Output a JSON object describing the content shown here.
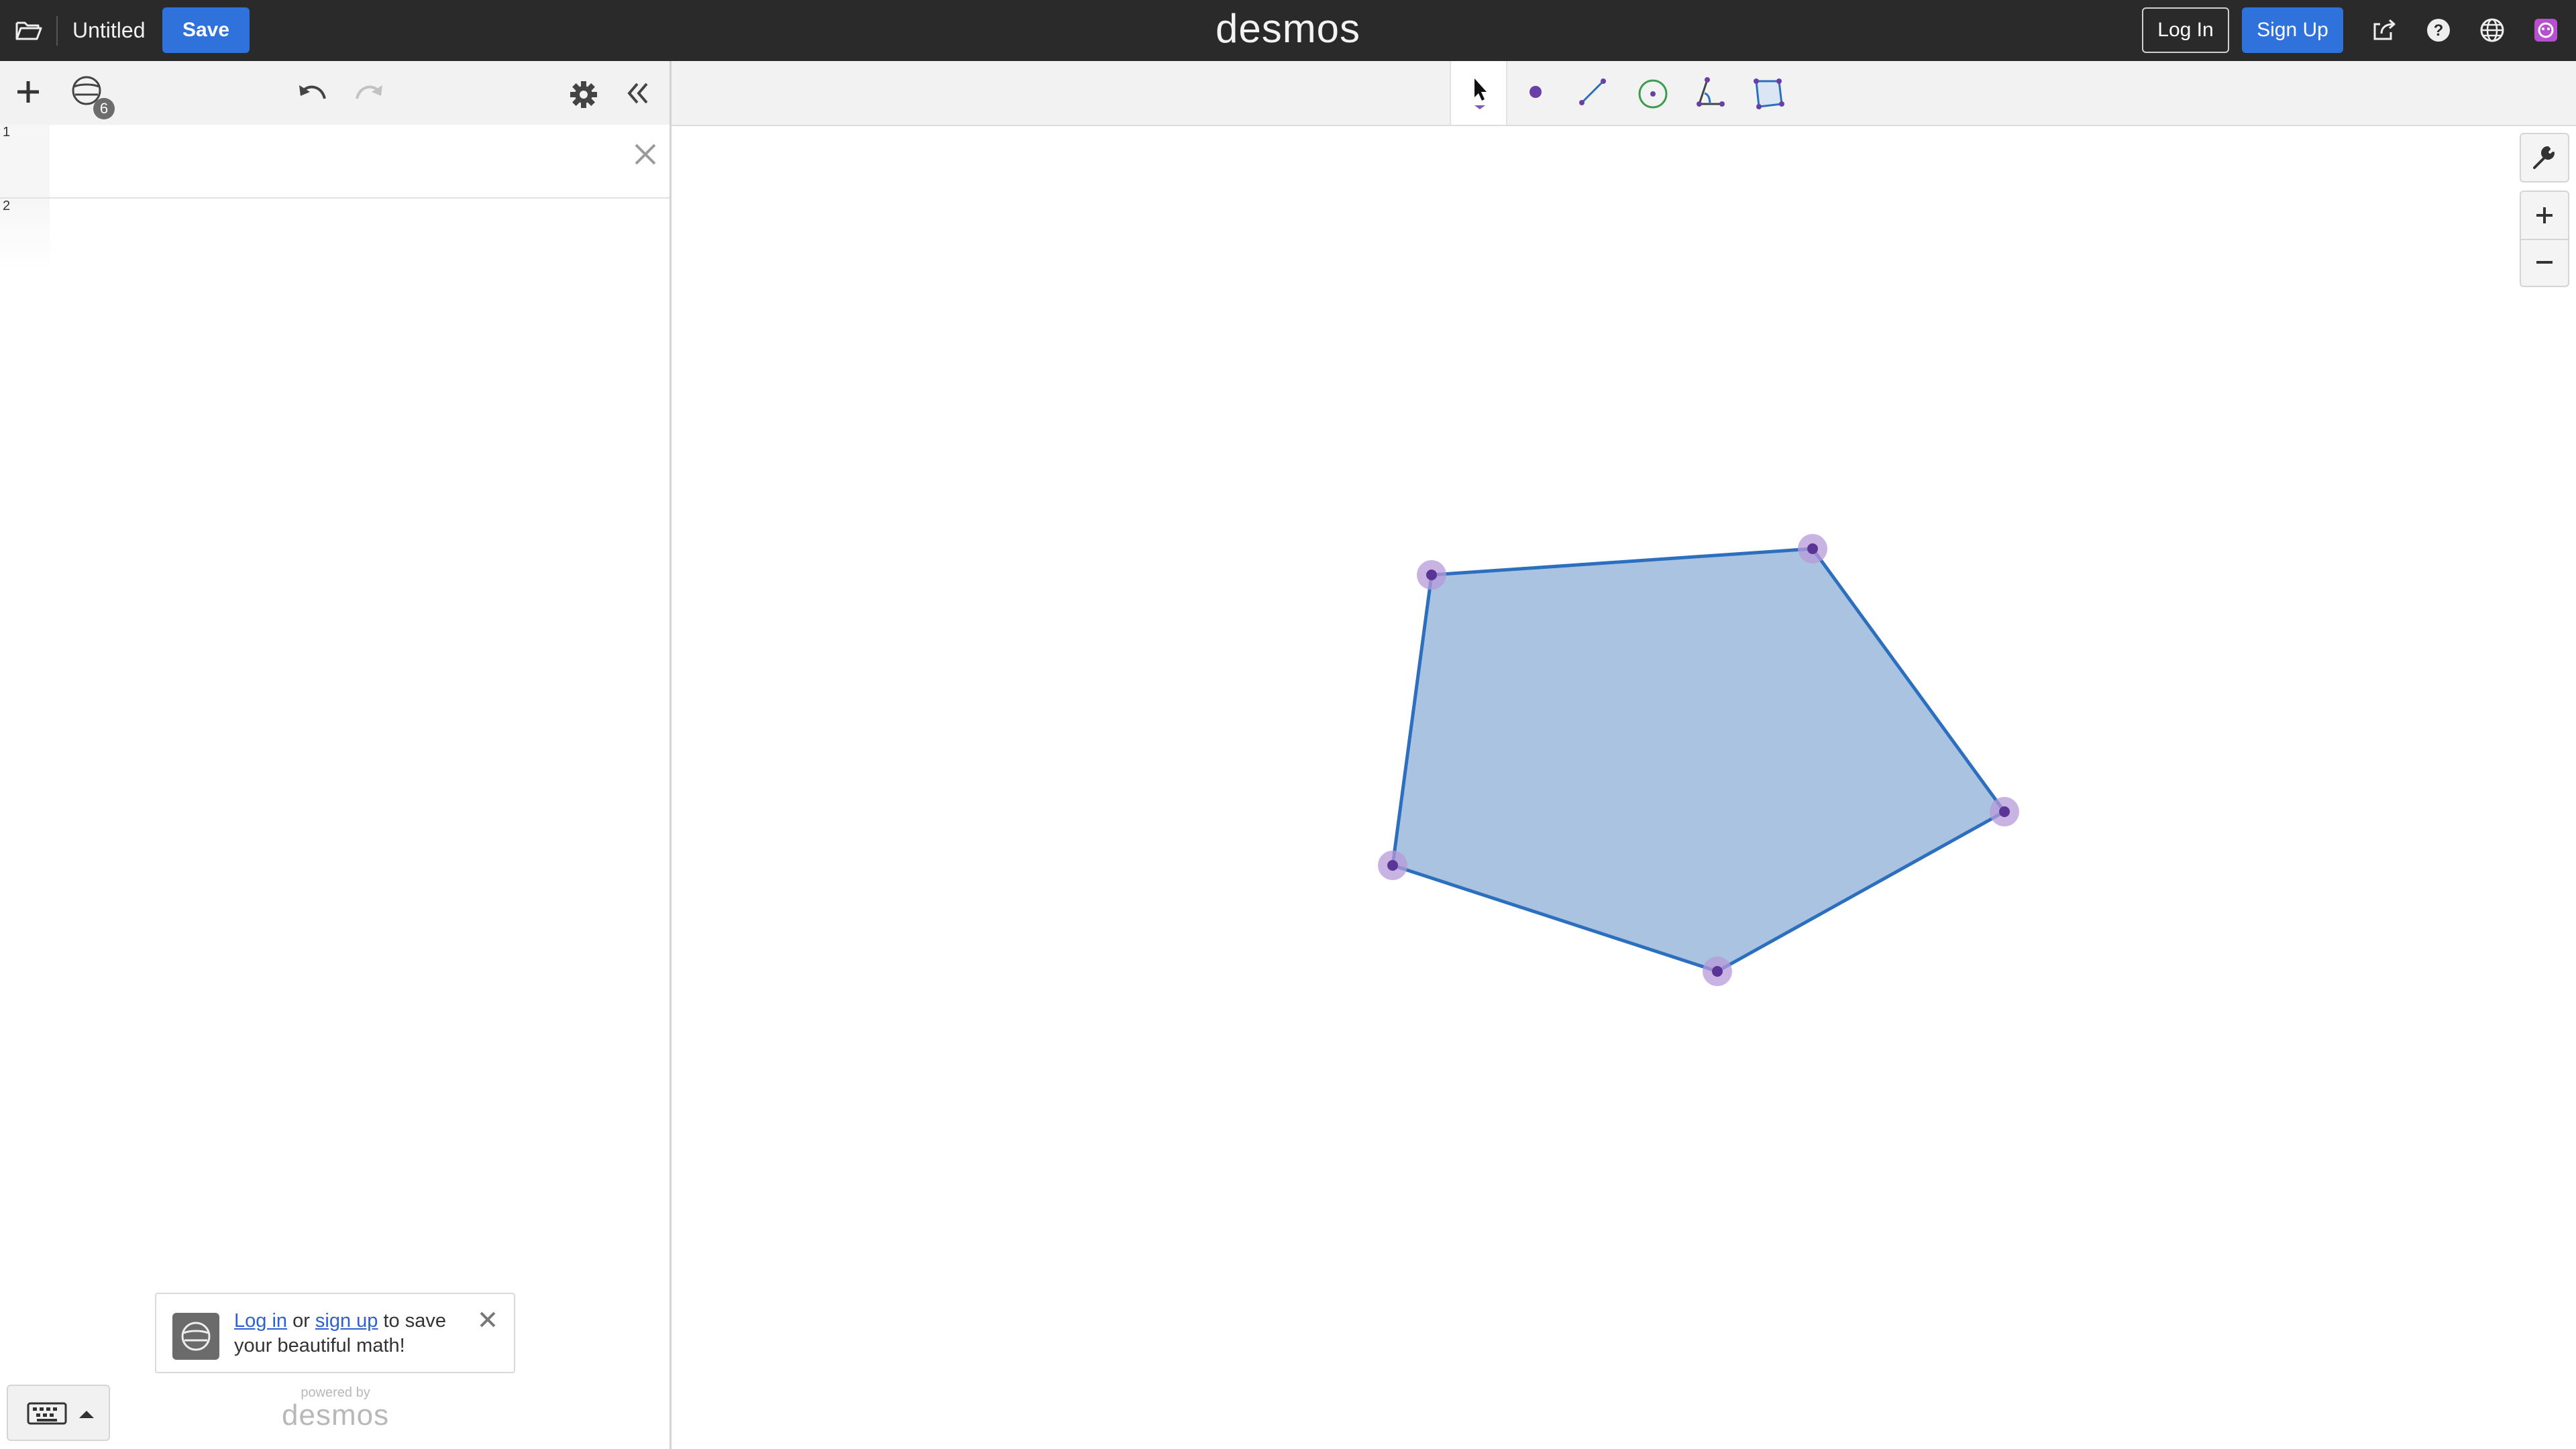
{
  "topbar": {
    "title": "Untitled",
    "save_label": "Save",
    "logo": "desmos",
    "login_label": "Log In",
    "signup_label": "Sign Up"
  },
  "expressions": {
    "graph_settings_badge": "6",
    "rows": [
      {
        "number": "1"
      },
      {
        "number": "2"
      }
    ]
  },
  "toast": {
    "login_link": "Log in",
    "or_text": " or ",
    "signup_link": "sign up",
    "message": " to save your beautiful math!"
  },
  "powered_by": {
    "small": "powered by",
    "big": "desmos"
  },
  "geometry_tools": [
    "select",
    "point",
    "segment",
    "circle",
    "angle",
    "polygon"
  ],
  "polygon": {
    "fill_color": "#a9c3e1",
    "stroke_color": "#2d6fbf",
    "point_color": "#6a3fa6",
    "vertex_count": 5
  },
  "colors": {
    "accent": "#2f72dc",
    "topbar_bg": "#2a2a2a"
  }
}
